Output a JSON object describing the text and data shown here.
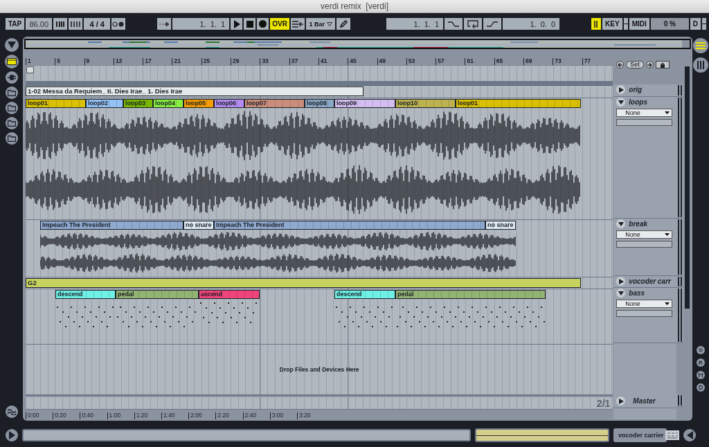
{
  "window": {
    "title": "verdi remix  [verdi]"
  },
  "transport": {
    "tap": "TAP",
    "tempo": "86.00",
    "signature": "4 / 4",
    "position": "1.  1.  1",
    "overdub": {
      "label": "OVR",
      "on": true
    },
    "quantize": "1 Bar",
    "loop_start": "1.  1.  1",
    "loop_length": "1.  0.  0",
    "computer_keyboard_on": true,
    "key": "KEY",
    "midi": "MIDI",
    "cpu": "0 %",
    "disk": "D"
  },
  "ruler": {
    "bars": [
      "1",
      "5",
      "9",
      "13",
      "17",
      "21",
      "25",
      "29",
      "33",
      "37",
      "41",
      "45",
      "49",
      "53",
      "57",
      "61",
      "65",
      "69",
      "73",
      "77"
    ]
  },
  "locators": {
    "set": "Set"
  },
  "tracks": [
    {
      "name": "orig",
      "kind": "audio",
      "expanded": false,
      "clips": [
        {
          "name": "1-02 Messa da Requiem_ II. Dies Irae_ 1. Dies Irae",
          "color": "#e4e9e9"
        }
      ]
    },
    {
      "name": "loops",
      "kind": "audio",
      "expanded": true,
      "input": "None",
      "clips": [
        {
          "name": "loop01",
          "color": "#d9c000"
        },
        {
          "name": "loop02",
          "color": "#94c2f5"
        },
        {
          "name": "loop03",
          "color": "#77b800"
        },
        {
          "name": "loop04",
          "color": "#88f041"
        },
        {
          "name": "loop05",
          "color": "#f59c00"
        },
        {
          "name": "loop06",
          "color": "#b48cf0"
        },
        {
          "name": "loop07",
          "color": "#c98d7a"
        },
        {
          "name": "loop08",
          "color": "#8aa7c4"
        },
        {
          "name": "loop09",
          "color": "#d4bdf0"
        },
        {
          "name": "loop10",
          "color": "#bcb250"
        },
        {
          "name": "loop01",
          "color": "#d9c000"
        }
      ]
    },
    {
      "name": "break",
      "kind": "audio",
      "expanded": true,
      "input": "None",
      "clips": [
        {
          "name": "Impeach The President",
          "color": "#8fa9cf"
        },
        {
          "name": "no snare",
          "color": "#dce9f3"
        },
        {
          "name": "Impeach The President",
          "color": "#8fa9cf"
        },
        {
          "name": "no snare",
          "color": "#dce9f3"
        }
      ]
    },
    {
      "name": "vocoder carr",
      "kind": "midi",
      "expanded": false,
      "clips": [
        {
          "name": "G2",
          "color": "#c5d25e"
        }
      ]
    },
    {
      "name": "bass",
      "kind": "midi",
      "expanded": true,
      "input": "None",
      "clips": [
        {
          "name": "descend",
          "color": "#6ef0e6"
        },
        {
          "name": "pedal",
          "color": "#93b374"
        },
        {
          "name": "ascend",
          "color": "#f0447a"
        },
        {
          "name": "descend",
          "color": "#6ef0e6"
        },
        {
          "name": "pedal",
          "color": "#93b374"
        }
      ]
    }
  ],
  "drop_hint": "Drop Files and Devices Here",
  "master": {
    "name": "Master",
    "zoom": "2/1"
  },
  "time_ruler": [
    "0:00",
    "0:20",
    "0:40",
    "1:00",
    "1:20",
    "1:40",
    "2:00",
    "2:20",
    "2:40",
    "3:00",
    "3:20"
  ],
  "status": {
    "selected_track": "vocoder carrier"
  }
}
